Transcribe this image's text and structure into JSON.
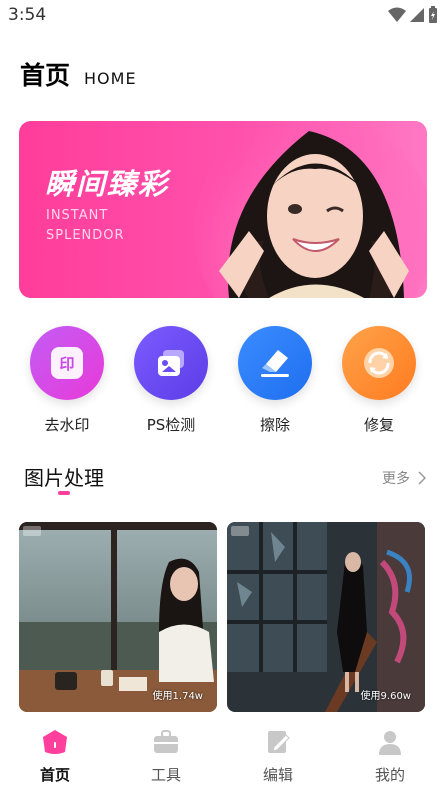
{
  "status_bar": {
    "time": "3:54"
  },
  "header": {
    "title": "首页",
    "subtitle": "HOME"
  },
  "banner": {
    "title": "瞬间臻彩",
    "subtitle": "INSTANT SPLENDOR"
  },
  "tools": [
    {
      "label": "去水印",
      "icon": "watermark-remove-icon",
      "color_start": "#c35cf5",
      "color_end": "#e83ad8"
    },
    {
      "label": "PS检测",
      "icon": "image-detect-icon",
      "color_start": "#7b5cff",
      "color_end": "#5c3ce6"
    },
    {
      "label": "擦除",
      "icon": "eraser-icon",
      "color_start": "#3b8cff",
      "color_end": "#1f6ff0"
    },
    {
      "label": "修复",
      "icon": "repair-icon",
      "color_start": "#ffa34a",
      "color_end": "#ff7b1f"
    }
  ],
  "section": {
    "title": "图片处理",
    "more_label": "更多"
  },
  "cards": [
    {
      "usage": "使用1.74w"
    },
    {
      "usage": "使用9.60w"
    }
  ],
  "tabs": [
    {
      "label": "首页",
      "icon": "home-icon",
      "active": true
    },
    {
      "label": "工具",
      "icon": "toolbox-icon",
      "active": false
    },
    {
      "label": "编辑",
      "icon": "edit-icon",
      "active": false
    },
    {
      "label": "我的",
      "icon": "profile-icon",
      "active": false
    }
  ],
  "colors": {
    "accent": "#ff3f9c",
    "banner": "#ff52ad"
  }
}
